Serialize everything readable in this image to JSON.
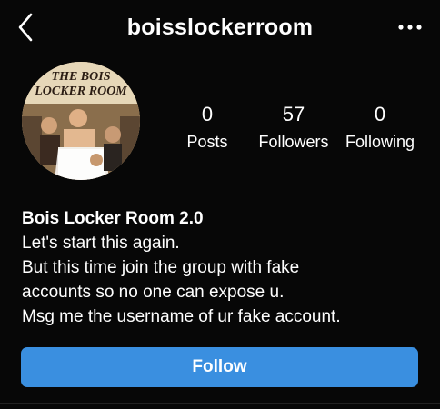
{
  "header": {
    "username": "boisslockerroom",
    "back_icon": "chevron-left-icon",
    "more_icon": "more-horizontal-icon"
  },
  "profile": {
    "avatar_caption": "THE BOIS LOCKER ROOM",
    "stats": [
      {
        "value": "0",
        "label": "Posts"
      },
      {
        "value": "57",
        "label": "Followers"
      },
      {
        "value": "0",
        "label": "Following"
      }
    ]
  },
  "bio": {
    "name": "Bois Locker Room 2.0",
    "lines": [
      "Let's start this again.",
      "But this time join the group with fake",
      "accounts so no one can expose u.",
      "Msg me the username of ur fake account."
    ]
  },
  "actions": {
    "follow_label": "Follow",
    "follow_color": "#3a8fe0"
  }
}
